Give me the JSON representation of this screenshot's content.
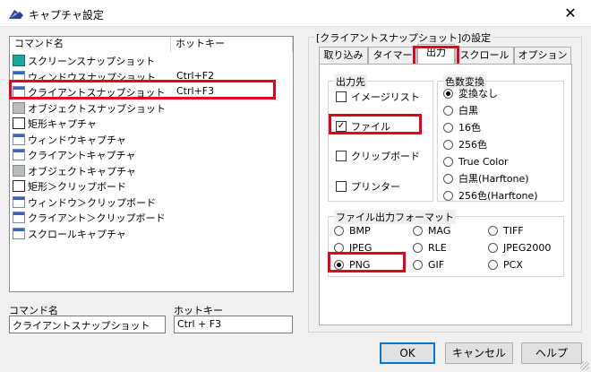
{
  "window": {
    "title": "キャプチャ設定"
  },
  "list": {
    "headers": {
      "name": "コマンド名",
      "hotkey": "ホットキー"
    },
    "rows": [
      {
        "name": "スクリーンスナップショット",
        "hotkey": "",
        "icon": "screen-icon"
      },
      {
        "name": "ウィンドウスナップショット",
        "hotkey": "Ctrl+F2",
        "icon": "window-icon"
      },
      {
        "name": "クライアントスナップショット",
        "hotkey": "Ctrl+F3",
        "icon": "client-icon"
      },
      {
        "name": "オブジェクトスナップショット",
        "hotkey": "",
        "icon": "object-icon"
      },
      {
        "name": "矩形キャプチャ",
        "hotkey": "",
        "icon": "rect-icon"
      },
      {
        "name": "ウィンドウキャプチャ",
        "hotkey": "",
        "icon": "window-icon"
      },
      {
        "name": "クライアントキャプチャ",
        "hotkey": "",
        "icon": "client-icon"
      },
      {
        "name": "オブジェクトキャプチャ",
        "hotkey": "",
        "icon": "object-icon"
      },
      {
        "name": "矩形＞クリップボード",
        "hotkey": "",
        "icon": "rect-icon"
      },
      {
        "name": "ウィンドウ＞クリップボード",
        "hotkey": "",
        "icon": "window-icon"
      },
      {
        "name": "クライアント＞クリップボード",
        "hotkey": "",
        "icon": "client-icon"
      },
      {
        "name": "スクロールキャプチャ",
        "hotkey": "",
        "icon": "client-icon"
      }
    ]
  },
  "edit": {
    "name_label": "コマンド名",
    "name_value": "クライアントスナップショット",
    "hotkey_label": "ホットキー",
    "hotkey_value": "Ctrl + F3"
  },
  "settings": {
    "group_title": "[クライアントスナップショット]の設定",
    "tabs": [
      "取り込み",
      "タイマー",
      "出力",
      "スクロール",
      "オプション"
    ],
    "active_tab": "出力",
    "output_group": {
      "title": "出力先",
      "items": [
        {
          "label": "イメージリスト",
          "checked": false
        },
        {
          "label": "ファイル",
          "checked": true
        },
        {
          "label": "クリップボード",
          "checked": false
        },
        {
          "label": "プリンター",
          "checked": false
        }
      ]
    },
    "color_group": {
      "title": "色数変換",
      "items": [
        {
          "label": "変換なし",
          "selected": true
        },
        {
          "label": "白黒",
          "selected": false
        },
        {
          "label": "16色",
          "selected": false
        },
        {
          "label": "256色",
          "selected": false
        },
        {
          "label": "True Color",
          "selected": false
        },
        {
          "label": "白黒(Harftone)",
          "selected": false
        },
        {
          "label": "256色(Harftone)",
          "selected": false
        }
      ]
    },
    "format_group": {
      "title": "ファイル出力フォーマット",
      "items": [
        {
          "label": "BMP",
          "selected": false
        },
        {
          "label": "MAG",
          "selected": false
        },
        {
          "label": "TIFF",
          "selected": false
        },
        {
          "label": "JPEG",
          "selected": false
        },
        {
          "label": "RLE",
          "selected": false
        },
        {
          "label": "JPEG2000",
          "selected": false
        },
        {
          "label": "PNG",
          "selected": true
        },
        {
          "label": "GIF",
          "selected": false
        },
        {
          "label": "PCX",
          "selected": false
        }
      ]
    }
  },
  "buttons": {
    "ok": "OK",
    "cancel": "キャンセル",
    "help": "ヘルプ"
  },
  "colors": {
    "highlight": "#e8001c",
    "accent": "#0078d7"
  }
}
